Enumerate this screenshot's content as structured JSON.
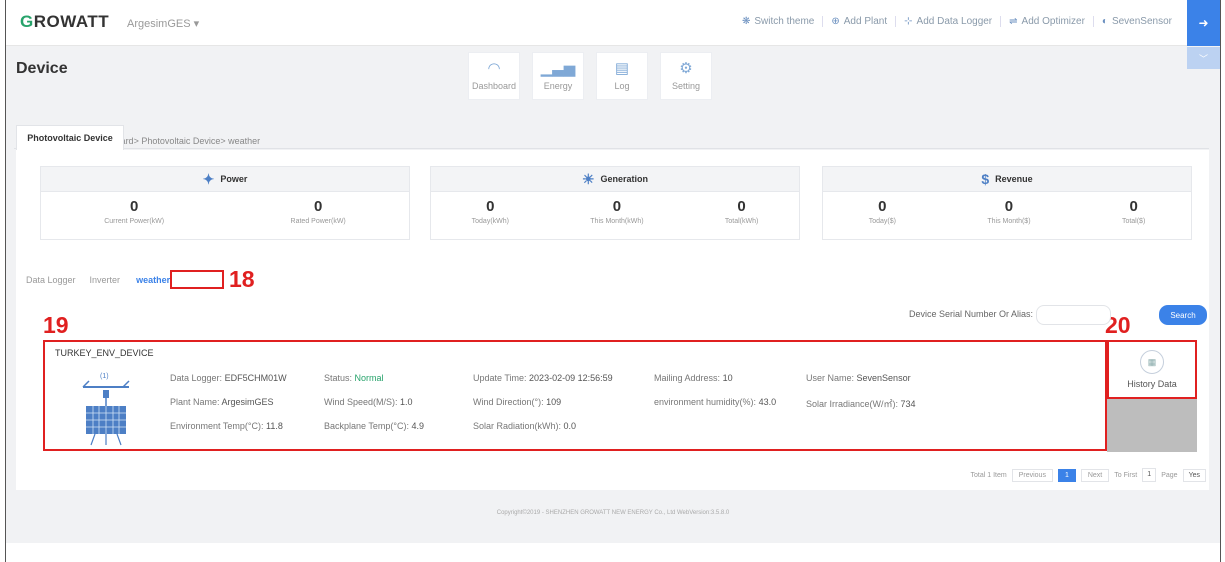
{
  "topbar": {
    "logo_bold": "G",
    "logo_rest": "ROWATT",
    "plant_select": "ArgesimGES ▾",
    "links": [
      {
        "icon": "theme-icon",
        "label": "Switch theme"
      },
      {
        "icon": "plant-icon",
        "label": "Add Plant"
      },
      {
        "icon": "datalogger-icon",
        "label": "Add Data Logger"
      },
      {
        "icon": "optimizer-icon",
        "label": "Add Optimizer"
      },
      {
        "icon": "user-icon",
        "label": "SevenSensor"
      }
    ]
  },
  "header": {
    "title": "Device",
    "nav": [
      {
        "icon": "dashboard-icon",
        "label": "Dashboard"
      },
      {
        "icon": "energy-icon",
        "label": "Energy"
      },
      {
        "icon": "log-icon",
        "label": "Log"
      },
      {
        "icon": "setting-icon",
        "label": "Setting"
      }
    ],
    "breadcrumb": "Current Location: Dashboard> Photovoltaic Device> weather"
  },
  "tab": "Photovoltaic Device",
  "summary": {
    "power": {
      "title": "Power",
      "items": [
        {
          "value": "0",
          "unit": "Current Power(kW)"
        },
        {
          "value": "0",
          "unit": "Rated Power(kW)"
        }
      ]
    },
    "generation": {
      "title": "Generation",
      "items": [
        {
          "value": "0",
          "unit": "Today(kWh)"
        },
        {
          "value": "0",
          "unit": "This Month(kWh)"
        },
        {
          "value": "0",
          "unit": "Total(kWh)"
        }
      ]
    },
    "revenue": {
      "title": "Revenue",
      "items": [
        {
          "value": "0",
          "unit": "Today($)"
        },
        {
          "value": "0",
          "unit": "This Month($)"
        },
        {
          "value": "0",
          "unit": "Total($)"
        }
      ]
    }
  },
  "device_tabs": [
    "Data Logger",
    "Inverter",
    "weather"
  ],
  "markers": {
    "m18": "18",
    "m19": "19",
    "m20": "20"
  },
  "search": {
    "label": "Device Serial Number Or Alias:",
    "placeholder": "",
    "button": "Search"
  },
  "device": {
    "name": "TURKEY_ENV_DEVICE",
    "badge": "(1)",
    "fields": {
      "data_logger": {
        "label": "Data Logger:",
        "value": "EDF5CHM01W"
      },
      "status": {
        "label": "Status:",
        "value": "Normal"
      },
      "update_time": {
        "label": "Update Time:",
        "value": "2023-02-09 12:56:59"
      },
      "mailing_address": {
        "label": "Mailing Address:",
        "value": "10"
      },
      "user_name": {
        "label": "User Name:",
        "value": "SevenSensor"
      },
      "plant_name": {
        "label": "Plant Name:",
        "value": "ArgesimGES"
      },
      "wind_speed": {
        "label": "Wind Speed(M/S):",
        "value": "1.0"
      },
      "wind_direction": {
        "label": "Wind Direction(°):",
        "value": "109"
      },
      "env_humidity": {
        "label": "environment humidity(%):",
        "value": "43.0"
      },
      "solar_irradiance": {
        "label": "Solar Irradiance(W/㎡):",
        "value": "734"
      },
      "env_temp": {
        "label": "Environment Temp(°C):",
        "value": "11.8"
      },
      "backplane_temp": {
        "label": "Backplane Temp(°C):",
        "value": "4.9"
      },
      "solar_radiation": {
        "label": "Solar Radiation(kWh):",
        "value": "0.0"
      }
    }
  },
  "history": {
    "label": "History Data"
  },
  "pager": {
    "total": "Total 1 Item",
    "prev": "Previous",
    "current": "1",
    "next": "Next",
    "to_first": "To First",
    "page_value": "1",
    "page_label": "Page",
    "go": "Yes"
  },
  "footer": "Copyright©2019 - SHENZHEN GROWATT NEW ENERGY Co., Ltd WebVersion:3.5.8.0"
}
